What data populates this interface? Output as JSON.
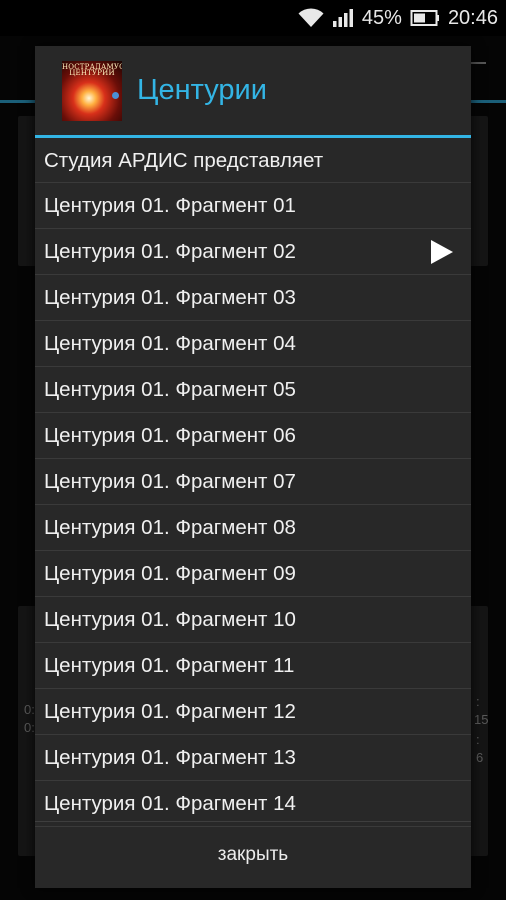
{
  "status_bar": {
    "battery_percent": "45%",
    "time": "20:46",
    "icons": [
      "wifi-icon",
      "signal-icon",
      "battery-icon"
    ]
  },
  "background": {
    "left_text_1": "0:",
    "left_text_2": "0:",
    "right_text_1": ":",
    "right_text_2": "15",
    "right_text_3": ":",
    "right_text_4": "6"
  },
  "dialog": {
    "title": "Центурии",
    "icon": {
      "name": "centuries-app-icon",
      "banner_text": "НОСТРАДАМУС ЦЕНТУРИИ"
    },
    "accent_color": "#33b5e5",
    "items": [
      {
        "label": "Студия АРДИС представляет",
        "playing": false
      },
      {
        "label": "Центурия 01. Фрагмент 01",
        "playing": false
      },
      {
        "label": "Центурия 01. Фрагмент 02",
        "playing": true
      },
      {
        "label": "Центурия 01. Фрагмент 03",
        "playing": false
      },
      {
        "label": "Центурия 01. Фрагмент 04",
        "playing": false
      },
      {
        "label": "Центурия 01. Фрагмент 05",
        "playing": false
      },
      {
        "label": "Центурия 01. Фрагмент 06",
        "playing": false
      },
      {
        "label": "Центурия 01. Фрагмент 07",
        "playing": false
      },
      {
        "label": "Центурия 01. Фрагмент 08",
        "playing": false
      },
      {
        "label": "Центурия 01. Фрагмент 09",
        "playing": false
      },
      {
        "label": "Центурия 01. Фрагмент 10",
        "playing": false
      },
      {
        "label": "Центурия 01. Фрагмент 11",
        "playing": false
      },
      {
        "label": "Центурия 01. Фрагмент 12",
        "playing": false
      },
      {
        "label": "Центурия 01. Фрагмент 13",
        "playing": false
      },
      {
        "label": "Центурия 01. Фрагмент 14",
        "playing": false
      }
    ],
    "close_label": "закрыть"
  }
}
